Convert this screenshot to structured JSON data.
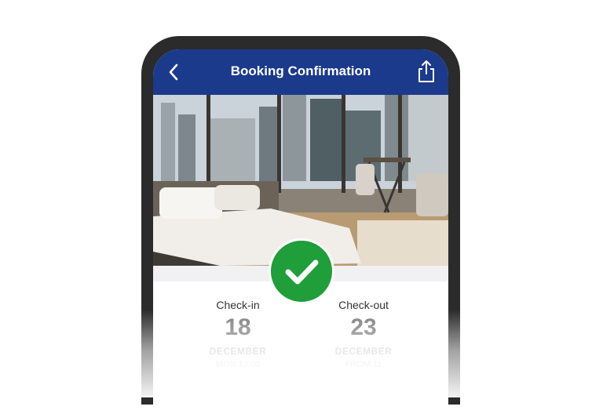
{
  "header": {
    "title": "Booking Confirmation",
    "back_icon": "chevron-left-icon",
    "share_icon": "share-icon"
  },
  "hero": {
    "image": "hotel-room-city-view-photo"
  },
  "status": {
    "icon": "checkmark-icon",
    "color": "#1f9e3a"
  },
  "dates": {
    "checkin": {
      "label": "Check-in",
      "day": "18",
      "month": "DECEMBER",
      "sub": "MON 12:00"
    },
    "checkout": {
      "label": "Check-out",
      "day": "23",
      "month": "DECEMBER",
      "sub": "FROM 11"
    }
  },
  "colors": {
    "header_bg": "#1b3a8c",
    "phone_frame": "#2b2b2b",
    "accent_green": "#1f9e3a"
  }
}
